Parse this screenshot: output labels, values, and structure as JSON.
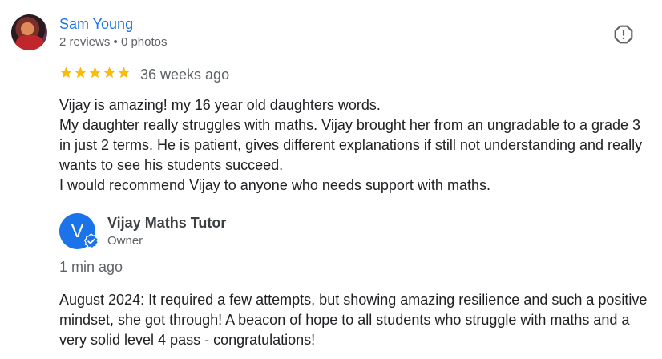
{
  "review": {
    "reviewer_name": "Sam Young",
    "reviewer_meta": "2 reviews • 0 photos",
    "rating": 5,
    "max_rating": 5,
    "age": "36 weeks ago",
    "text_lines": [
      "Vijay is amazing! my 16 year old daughters words.",
      "My daughter really struggles with maths. Vijay brought her from an ungradable to a grade 3 in just 2 terms. He is patient, gives different explanations if still not understanding and really wants to see his students succeed.",
      "I would recommend Vijay to anyone who needs support with maths."
    ]
  },
  "owner_response": {
    "avatar_letter": "V",
    "name": "Vijay Maths Tutor",
    "role": "Owner",
    "age": "1 min ago",
    "text": "August 2024: It required a few attempts, but showing amazing resilience and such a positive mindset, she got through! A beacon of hope to all students who struggle with maths and a very solid level 4 pass - congratulations!"
  },
  "colors": {
    "link": "#1a73e8",
    "star": "#fbbc04",
    "owner_avatar": "#1a73e8",
    "muted_text": "#5f6368"
  },
  "icons": {
    "report": "flag-report-icon",
    "star": "star-icon",
    "verified": "verified-badge-icon"
  }
}
